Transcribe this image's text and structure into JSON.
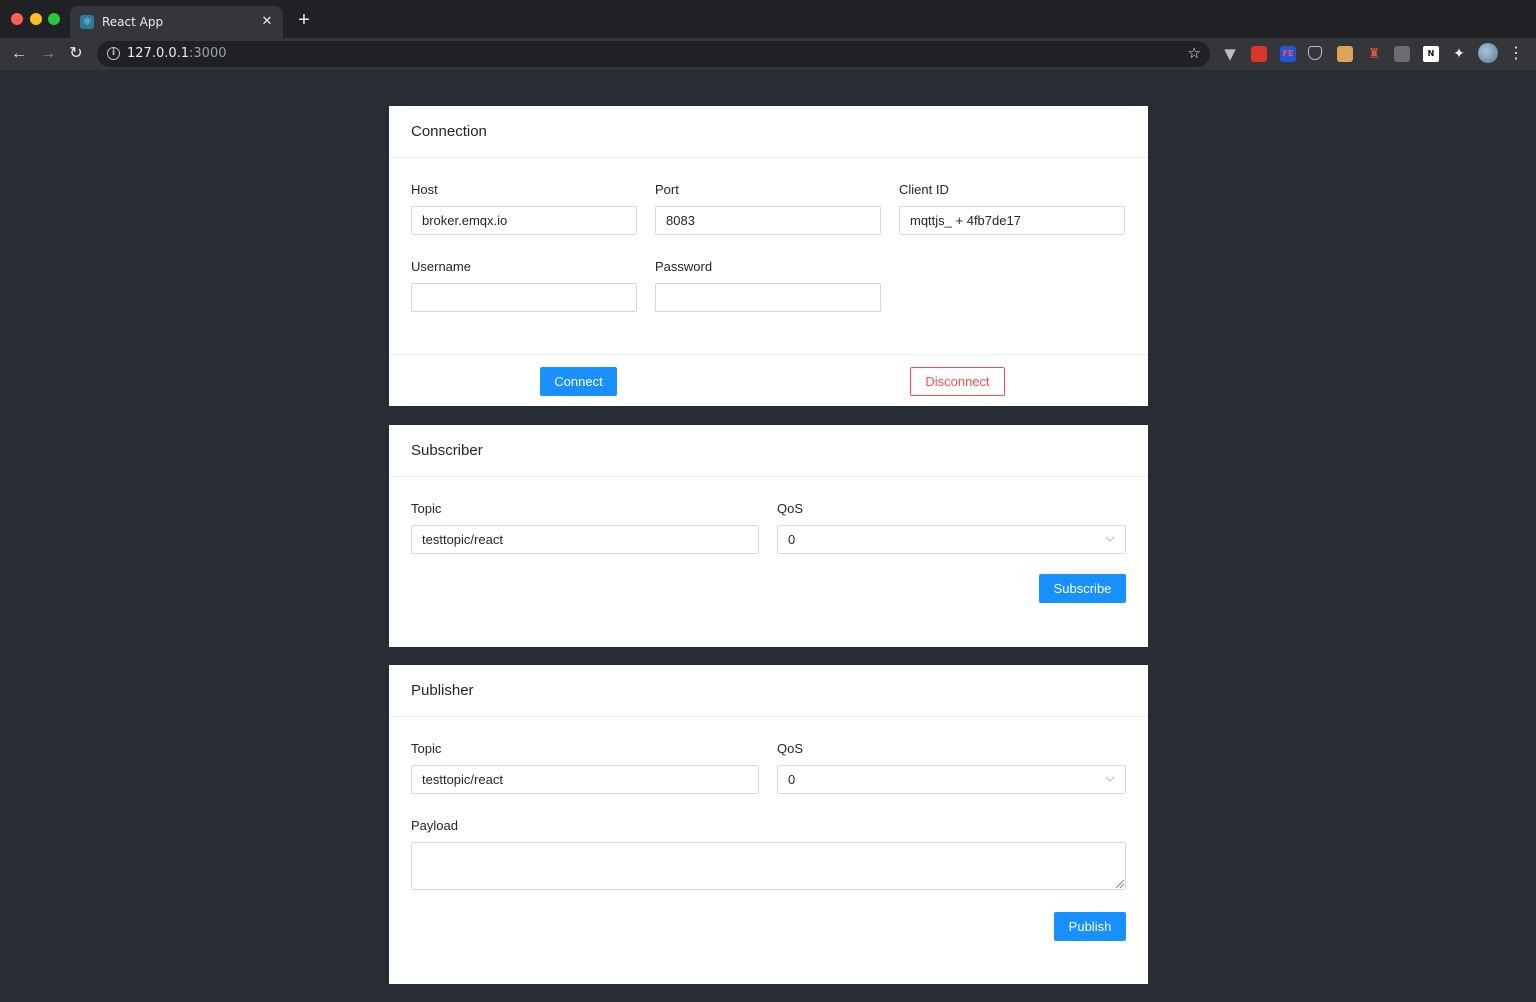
{
  "browser": {
    "tab_title": "React App",
    "tab_icon": "react-logo-icon",
    "url_host": "127.0.0.1",
    "url_port": ":3000"
  },
  "connection": {
    "title": "Connection",
    "host_label": "Host",
    "host_value": "broker.emqx.io",
    "port_label": "Port",
    "port_value": "8083",
    "client_id_label": "Client ID",
    "client_id_value": "mqttjs_ + 4fb7de17",
    "username_label": "Username",
    "username_value": "",
    "password_label": "Password",
    "password_value": "",
    "connect_label": "Connect",
    "disconnect_label": "Disconnect"
  },
  "subscriber": {
    "title": "Subscriber",
    "topic_label": "Topic",
    "topic_value": "testtopic/react",
    "qos_label": "QoS",
    "qos_value": "0",
    "subscribe_label": "Subscribe"
  },
  "publisher": {
    "title": "Publisher",
    "topic_label": "Topic",
    "topic_value": "testtopic/react",
    "qos_label": "QoS",
    "qos_value": "0",
    "payload_label": "Payload",
    "payload_value": "",
    "publish_label": "Publish"
  },
  "colors": {
    "page_background": "#282c34",
    "primary": "#1890ff",
    "danger": "#ff4d4f"
  }
}
